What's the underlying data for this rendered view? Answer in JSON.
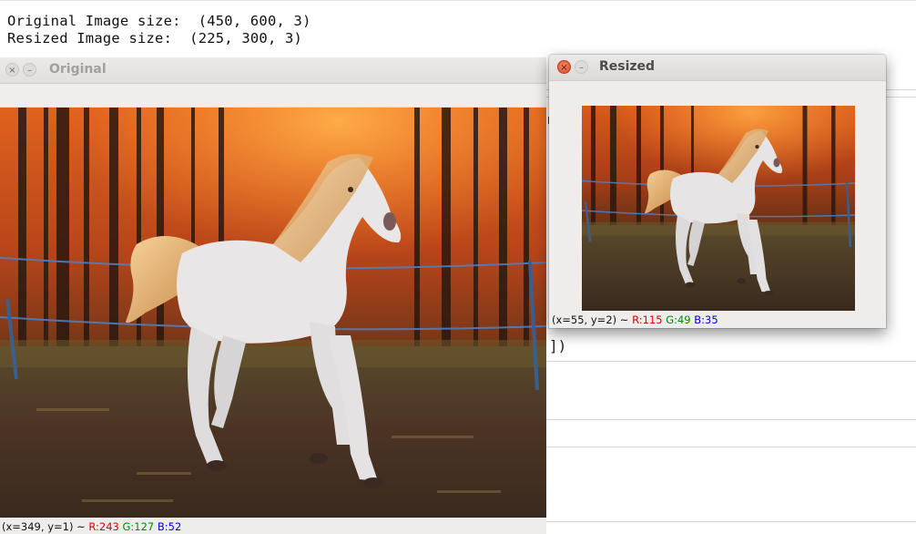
{
  "console": {
    "line1": "Original Image size:  (450, 600, 3)",
    "line2": "Resized Image size:  (225, 300, 3)"
  },
  "background": {
    "bracket_text": "])"
  },
  "windows": {
    "original": {
      "title": "Original",
      "close_glyph": "×",
      "min_glyph": "–",
      "status": {
        "coords": "(x=349, y=1) ~ ",
        "r": "R:243",
        "g": "G:127",
        "b": "B:52"
      }
    },
    "resized": {
      "title": "Resized",
      "close_glyph": "×",
      "min_glyph": "–",
      "status": {
        "coords": "(x=55, y=2) ~ ",
        "r": "R:115",
        "g": "G:49",
        "b": "B:35"
      }
    }
  },
  "icons": {
    "close": "close-icon",
    "minimize": "minimize-icon"
  },
  "colors": {
    "status_r": "#e00000",
    "status_g": "#008a00",
    "status_b": "#0000e0",
    "close_button_active": "#df4b26"
  }
}
